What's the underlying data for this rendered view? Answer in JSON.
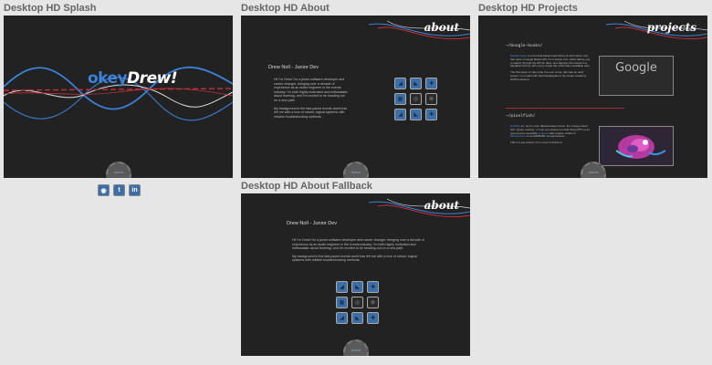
{
  "artboards": {
    "splash": {
      "title": "Desktop HD Splash",
      "logo_prefix": "okey",
      "logo_name": "Drew!"
    },
    "about": {
      "title": "Desktop HD About",
      "section_title": "about"
    },
    "projects": {
      "title": "Desktop HD Projects",
      "section_title": "projects"
    },
    "fallback": {
      "title": "Desktop HD About Fallback",
      "section_title": "about"
    }
  },
  "menu": {
    "label": "menu"
  },
  "about_content": {
    "heading": "Drew Noll - Junior Dev",
    "para1": "Hi! I'm Drew! I'm a junior software developer and career changer, bringing over a decade of experience as an audio engineer in the events industry. I'm both highly motivated and enthusiastic about learning, and I'm excited to be heading out on a new path.",
    "para2": "My background in the fast-paced events world has left me with a love of robust, logical systems with reliable troubleshooting methods."
  },
  "projects_content": {
    "proj1_heading": "~/boogle-books/",
    "proj1_name": "Boogle books",
    "proj1_desc": "is a terminal based book library & information tool that uses a Google Books API. It's a simple tool, which allows you to search through the API for titles, and displays the results in a tabulated format, with every simple title information available also.",
    "proj1_desc2": "The first piece of ruby code I've ever wrote, this was an early project I co-coded with Matt Dealtaguda in the Coder Academy 2018 bootcamp.",
    "proj1_image_text": "Google",
    "proj2_heading": "~/pixelfish/",
    "proj2_name": "pixelfish",
    "proj2_desc": "(or, as it's more affectionately known, the 'creepy-clown' fish, 'space cowboy', or 'can you please turn that thing off?!') is an open-source wearable",
    "proj2_link": "neopixel",
    "proj2_desc_tail": "LED project, written in",
    "proj2_link2": "Micropython",
    "proj2_desc_end": "on an ESP8266 microprocessor.",
    "proj2_desc2": "This is a pet project, born out of a desire to"
  },
  "social_icons": [
    "github-icon",
    "twitter-icon",
    "linkedin-icon"
  ],
  "social_glyphs": {
    "github": "◉",
    "twitter": "t",
    "linkedin": "in"
  },
  "colors": {
    "wave_blue": "#3c82d8",
    "wave_red": "#c0303c",
    "wave_white": "#dddddd",
    "accent": "#3c6fa8"
  }
}
